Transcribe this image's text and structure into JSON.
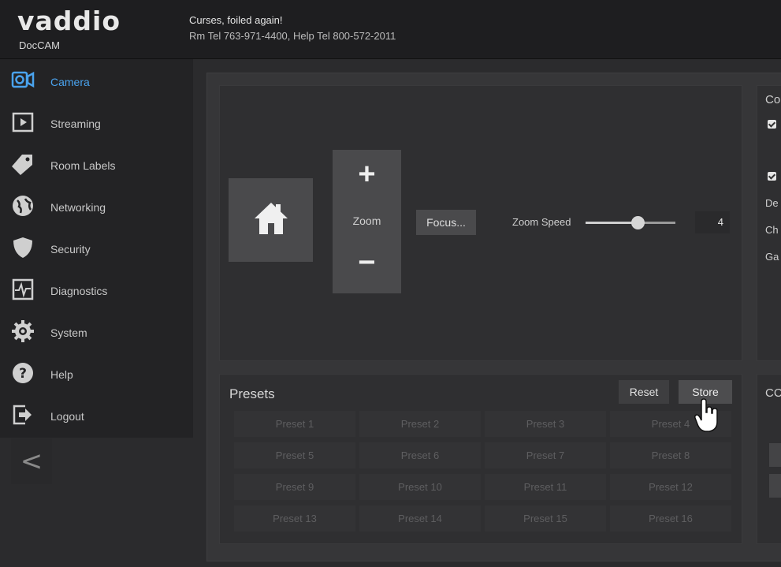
{
  "header": {
    "logo": "vaddio",
    "product": "DocCAM",
    "message": "Curses, foiled again!",
    "contact": "Rm Tel 763-971-4400, Help Tel 800-572-2011"
  },
  "sidebar": {
    "items": [
      {
        "label": "Camera",
        "icon": "camera-icon",
        "active": true
      },
      {
        "label": "Streaming",
        "icon": "play-icon"
      },
      {
        "label": "Room Labels",
        "icon": "tag-icon"
      },
      {
        "label": "Networking",
        "icon": "globe-icon"
      },
      {
        "label": "Security",
        "icon": "shield-icon"
      },
      {
        "label": "Diagnostics",
        "icon": "pulse-icon"
      },
      {
        "label": "System",
        "icon": "gear-icon"
      },
      {
        "label": "Help",
        "icon": "question-icon"
      },
      {
        "label": "Logout",
        "icon": "logout-icon"
      }
    ],
    "collapse": "<"
  },
  "camera": {
    "zoom_plus": "+",
    "zoom_label": "Zoom",
    "zoom_minus": "−",
    "focus": "Focus...",
    "zoom_speed_label": "Zoom Speed",
    "zoom_speed_value": "4",
    "zoom_speed_fraction": 0.6
  },
  "presets": {
    "title": "Presets",
    "reset": "Reset",
    "store": "Store",
    "items": [
      "Preset 1",
      "Preset 2",
      "Preset 3",
      "Preset 4",
      "Preset 5",
      "Preset 6",
      "Preset 7",
      "Preset 8",
      "Preset 9",
      "Preset 10",
      "Preset 11",
      "Preset 12",
      "Preset 13",
      "Preset 14",
      "Preset 15",
      "Preset 16"
    ]
  },
  "right": {
    "co1": "Co",
    "de": "De",
    "ch": "Ch",
    "ga": "Ga",
    "co2": "CC"
  },
  "colors": {
    "accent": "#4aa3ee",
    "background": "#2b2b2d"
  }
}
